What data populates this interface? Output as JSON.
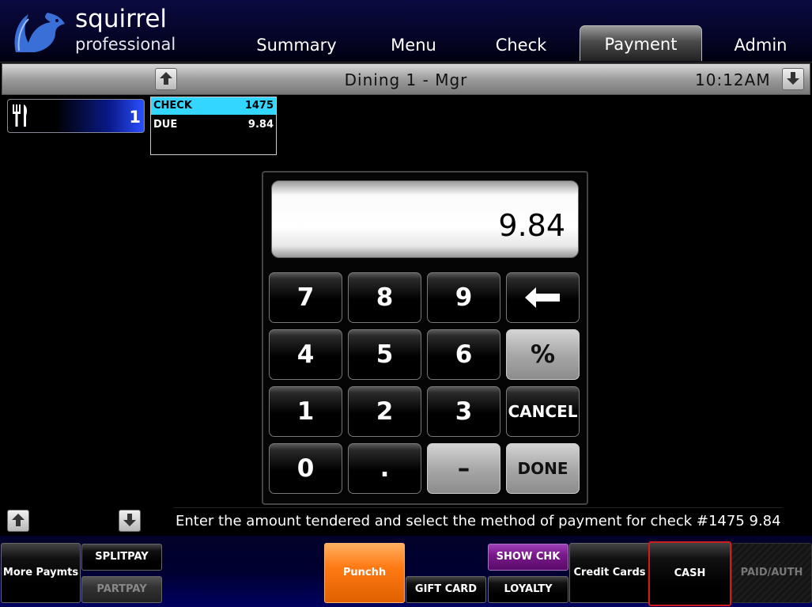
{
  "app": {
    "logo_name": "squirrel",
    "logo_sub": "professional"
  },
  "tabs": [
    {
      "label": "Summary"
    },
    {
      "label": "Menu"
    },
    {
      "label": "Check"
    },
    {
      "label": "Payment",
      "active": true
    },
    {
      "label": "Admin"
    }
  ],
  "status": {
    "title": "Dining 1 - Mgr",
    "time": "10:12AM"
  },
  "table": {
    "number": "1"
  },
  "check": {
    "rows": [
      {
        "label": "CHECK",
        "value": "1475"
      },
      {
        "label": "DUE",
        "value": "9.84"
      }
    ]
  },
  "keypad": {
    "display": "9.84",
    "keys": {
      "k7": "7",
      "k8": "8",
      "k9": "9",
      "k4": "4",
      "k5": "5",
      "k6": "6",
      "percent": "%",
      "k1": "1",
      "k2": "2",
      "k3": "3",
      "cancel": "CANCEL",
      "k0": "0",
      "dot": ".",
      "minus": "–",
      "done": "DONE"
    }
  },
  "message": "Enter the amount tendered and select the method of payment for check #1475 9.84",
  "bottom": {
    "more_paymts": "More Paymts",
    "splitpay": "SPLITPAY",
    "partpay": "PARTPAY",
    "punchh": "Punchh",
    "gift_card": "GIFT CARD",
    "show_chk": "SHOW CHK",
    "loyalty": "LOYALTY",
    "credit_cards": "Credit Cards",
    "cash": "CASH",
    "paid_auth": "PAID/AUTH"
  },
  "colors": {
    "check_highlight": "#33d6ff",
    "punchh": "#ff7a14",
    "show_chk": "#7a1a8a",
    "cash_border": "#cc1e1e",
    "active_tab": "#6e6e6e"
  }
}
